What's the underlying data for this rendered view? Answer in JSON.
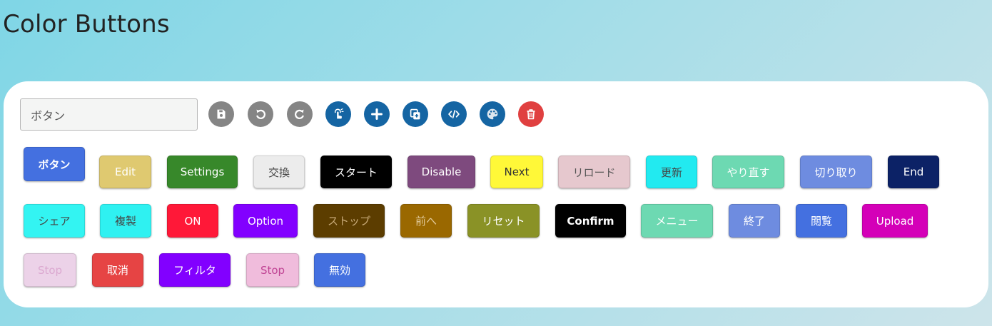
{
  "page": {
    "title": "Color Buttons"
  },
  "toolbar": {
    "input_value": "ボタン",
    "icons": [
      {
        "name": "save-icon",
        "color": "#858585"
      },
      {
        "name": "undo-icon",
        "color": "#858585"
      },
      {
        "name": "redo-icon",
        "color": "#858585"
      },
      {
        "name": "touch-icon",
        "color": "#1565a3"
      },
      {
        "name": "plus-icon",
        "color": "#1565a3"
      },
      {
        "name": "add-copy-icon",
        "color": "#1565a3"
      },
      {
        "name": "code-icon",
        "color": "#1565a3"
      },
      {
        "name": "palette-icon",
        "color": "#1565a3"
      },
      {
        "name": "trash-icon",
        "color": "#e04040"
      }
    ]
  },
  "buttons": {
    "row1": [
      {
        "label": "ボタン",
        "bg": "#4470e0",
        "fg": "#ffffff"
      },
      {
        "label": "Edit",
        "bg": "#dfc970",
        "fg": "#ffffff"
      },
      {
        "label": "Settings",
        "bg": "#37882a",
        "fg": "#ffffff"
      },
      {
        "label": "交換",
        "bg": "#ececec",
        "fg": "#444444"
      },
      {
        "label": "スタート",
        "bg": "#000000",
        "fg": "#ffffff"
      },
      {
        "label": "Disable",
        "bg": "#7e4a7e",
        "fg": "#ffffff"
      },
      {
        "label": "Next",
        "bg": "#fff838",
        "fg": "#333333"
      },
      {
        "label": "リロード",
        "bg": "#e6c8ce",
        "fg": "#555555"
      },
      {
        "label": "更新",
        "bg": "#22eaf0",
        "fg": "#444444"
      },
      {
        "label": "やり直す",
        "bg": "#6dd9b2",
        "fg": "#ffffff"
      },
      {
        "label": "切り取り",
        "bg": "#6e8ce0",
        "fg": "#ffffff"
      },
      {
        "label": "End",
        "bg": "#0c2266",
        "fg": "#ffffff"
      }
    ],
    "row2": [
      {
        "label": "シェア",
        "bg": "#33f4f2",
        "fg": "#444444"
      },
      {
        "label": "複製",
        "bg": "#2ff1f1",
        "fg": "#444444"
      },
      {
        "label": "ON",
        "bg": "#ff1838",
        "fg": "#ffffff"
      },
      {
        "label": "Option",
        "bg": "#8200ff",
        "fg": "#ffffff"
      },
      {
        "label": "ストップ",
        "bg": "#5c3d00",
        "fg": "#c8aa78"
      },
      {
        "label": "前へ",
        "bg": "#9a6800",
        "fg": "#e0c898"
      },
      {
        "label": "リセット",
        "bg": "#8a9226",
        "fg": "#ffffff"
      },
      {
        "label": "Confirm",
        "bg": "#000000",
        "fg": "#ffffff"
      },
      {
        "label": "メニュー",
        "bg": "#6dd9b2",
        "fg": "#ffffff"
      },
      {
        "label": "終了",
        "bg": "#6e8ce0",
        "fg": "#ffffff"
      },
      {
        "label": "閲覧",
        "bg": "#4470e0",
        "fg": "#ffffff"
      },
      {
        "label": "Upload",
        "bg": "#d400b8",
        "fg": "#ffffff"
      }
    ],
    "row3": [
      {
        "label": "Stop",
        "bg": "#ecd2e8",
        "fg": "#dba8d0"
      },
      {
        "label": "取消",
        "bg": "#e64444",
        "fg": "#ffffff"
      },
      {
        "label": "フィルタ",
        "bg": "#8200ff",
        "fg": "#ffffff"
      },
      {
        "label": "Stop",
        "bg": "#f0bcdc",
        "fg": "#c04494"
      },
      {
        "label": "無効",
        "bg": "#4470e0",
        "fg": "#ffffff"
      }
    ]
  }
}
